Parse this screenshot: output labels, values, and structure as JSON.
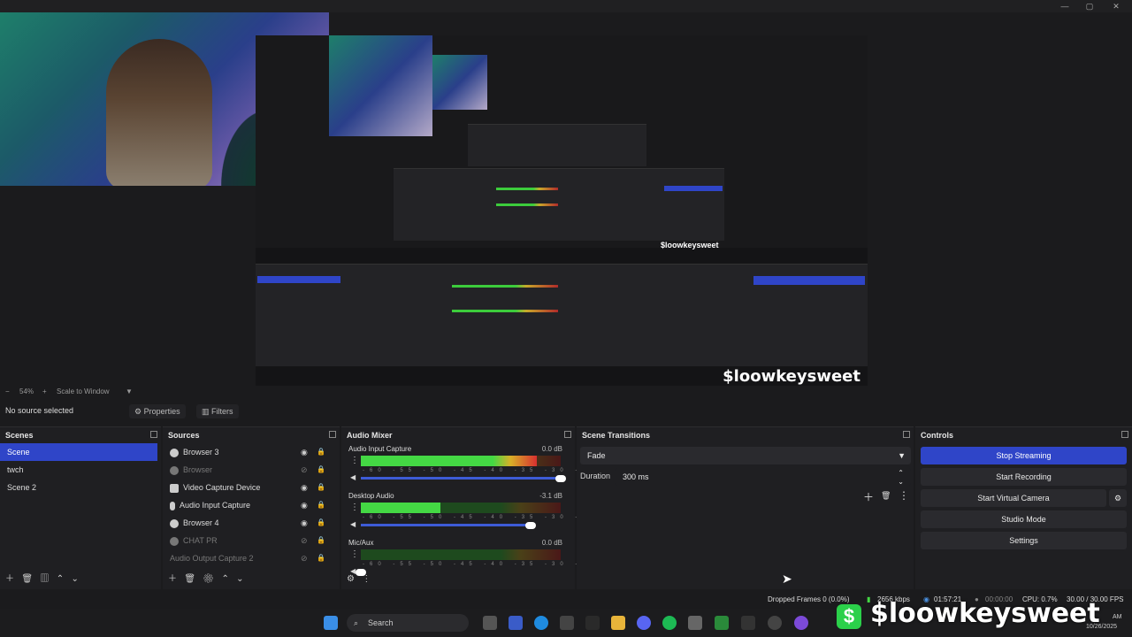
{
  "window": {
    "minimize": "—",
    "maximize": "▢",
    "close": "✕"
  },
  "preview": {
    "nested_watermark": "$loowkeysweet",
    "nested_small_watermark": "$loowkeysweet"
  },
  "zoombar": {
    "zoom": "54%",
    "mode": "Scale to Window"
  },
  "source_bar": {
    "no_source": "No source selected",
    "properties": "Properties",
    "filters": "Filters"
  },
  "scenes": {
    "title": "Scenes",
    "items": [
      {
        "label": "Scene",
        "selected": true
      },
      {
        "label": "twch",
        "selected": false
      },
      {
        "label": "Scene 2",
        "selected": false
      }
    ]
  },
  "sources": {
    "title": "Sources",
    "items": [
      {
        "label": "Browser 3",
        "visible": true
      },
      {
        "label": "Browser",
        "visible": false
      },
      {
        "label": "Video Capture Device",
        "visible": true
      },
      {
        "label": "Audio Input Capture",
        "visible": true
      },
      {
        "label": "Browser 4",
        "visible": true
      },
      {
        "label": "CHAT PR",
        "visible": false
      },
      {
        "label": "Audio Output Capture 2",
        "visible": false
      }
    ]
  },
  "audio_mixer": {
    "title": "Audio Mixer",
    "channels": [
      {
        "label": "Audio Input Capture",
        "db": "0.0 dB",
        "level": 0.88,
        "volume": 1.0
      },
      {
        "label": "Desktop Audio",
        "db": "-3.1 dB",
        "level": 0.4,
        "volume": 0.85
      },
      {
        "label": "Mic/Aux",
        "db": "0.0 dB",
        "level": 0.0,
        "volume": 0.0
      }
    ],
    "scale": "-60 -55 -50 -45 -40 -35 -30 -25 -20 -15 -10 -5 0"
  },
  "scene_transitions": {
    "title": "Scene Transitions",
    "transition": "Fade",
    "duration_label": "Duration",
    "duration_value": "300 ms"
  },
  "controls": {
    "title": "Controls",
    "stop_streaming": "Stop Streaming",
    "start_recording": "Start Recording",
    "start_virtual_camera": "Start Virtual Camera",
    "studio_mode": "Studio Mode",
    "settings": "Settings"
  },
  "status": {
    "dropped_frames": "Dropped Frames 0 (0.0%)",
    "bitrate": "2656 kbps",
    "stream_time": "01:57:21",
    "rec_time": "00:00:00",
    "cpu": "CPU: 0.7%",
    "fps": "30.00 / 30.00 FPS"
  },
  "taskbar": {
    "search": "Search",
    "date": "10/26/2025",
    "time_suffix": "AM"
  },
  "watermark": {
    "text": "$loowkeysweet",
    "badge": "$"
  },
  "colors": {
    "accent": "#2f45c8",
    "meter_green": "#44d844",
    "brand_green": "#2bd04a"
  }
}
